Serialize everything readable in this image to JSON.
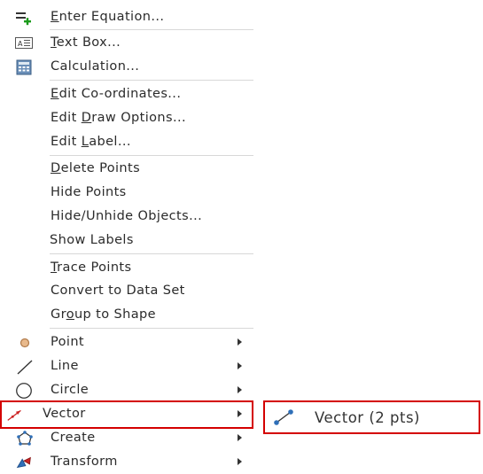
{
  "menu": {
    "items": [
      {
        "label_pre": "",
        "label_u": "E",
        "label_post": "nter Equation..."
      },
      {
        "label_pre": "",
        "label_u": "T",
        "label_post": "ext Box..."
      },
      {
        "label_pre": "Calculation...",
        "label_u": "",
        "label_post": ""
      },
      {
        "label_pre": "",
        "label_u": "E",
        "label_post": "dit Co-ordinates..."
      },
      {
        "label_pre": "Edit ",
        "label_u": "D",
        "label_post": "raw Options..."
      },
      {
        "label_pre": "Edit ",
        "label_u": "L",
        "label_post": "abel..."
      },
      {
        "label_pre": "",
        "label_u": "D",
        "label_post": "elete Points"
      },
      {
        "label_pre": "Hide Points",
        "label_u": "",
        "label_post": ""
      },
      {
        "label_pre": "Hide/Unhide Objects...",
        "label_u": "",
        "label_post": ""
      },
      {
        "label_pre": "Show Labels",
        "label_u": "",
        "label_post": ""
      },
      {
        "label_pre": "",
        "label_u": "T",
        "label_post": "race Points"
      },
      {
        "label_pre": "Convert to Data Set",
        "label_u": "",
        "label_post": ""
      },
      {
        "label_pre": "Gr",
        "label_u": "o",
        "label_post": "up to Shape"
      },
      {
        "label_pre": "Point",
        "label_u": "",
        "label_post": ""
      },
      {
        "label_pre": "Line",
        "label_u": "",
        "label_post": ""
      },
      {
        "label_pre": "Circle",
        "label_u": "",
        "label_post": ""
      },
      {
        "label_pre": "Vector",
        "label_u": "",
        "label_post": ""
      },
      {
        "label_pre": "Create",
        "label_u": "",
        "label_post": ""
      },
      {
        "label_pre": "Transform",
        "label_u": "",
        "label_post": ""
      }
    ]
  },
  "submenu": {
    "label": "Vector (2 pts)",
    "icon": "vector-two-points-icon"
  },
  "colors": {
    "highlight_border": "#d40000",
    "plus_green": "#1a9a1a",
    "point_fill": "#e8b98c",
    "vector_red": "#cc2222",
    "vector_blue": "#2f6fb8"
  }
}
